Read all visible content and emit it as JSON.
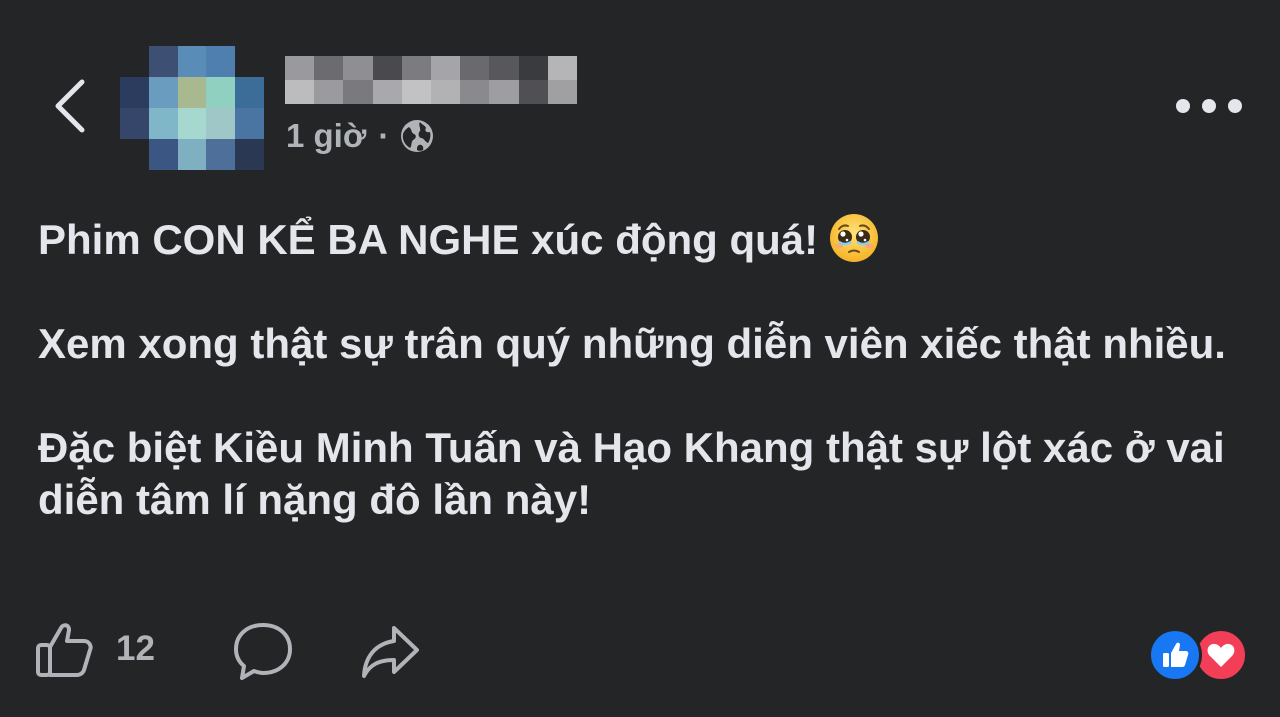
{
  "header": {
    "author_name": "",
    "timestamp": "1 giờ",
    "separator": "·",
    "audience_icon": "globe-icon",
    "back_icon": "chevron-left-icon",
    "more_icon": "more-horizontal-icon"
  },
  "post": {
    "line1": "Phim CON KỂ BA NGHE xúc động quá!",
    "emoji": "pleading-face-emoji",
    "para2": "Xem xong thật sự trân quý những diễn viên xiếc thật nhiều.",
    "para3": "Đặc biệt Kiều Minh Tuấn và Hạo Khang thật sự lột xác ở vai diễn tâm lí nặng đô lần này!"
  },
  "footer": {
    "like_icon": "thumbs-up-outline-icon",
    "like_count": "12",
    "comment_icon": "comment-bubble-icon",
    "share_icon": "share-arrow-icon",
    "reactions": [
      "like-reaction-icon",
      "love-reaction-icon"
    ]
  },
  "colors": {
    "background": "#242527",
    "text_primary": "#e4e6eb",
    "text_secondary": "#b0b3b8",
    "like_blue": "#1877f2",
    "love_red": "#f33e58"
  }
}
